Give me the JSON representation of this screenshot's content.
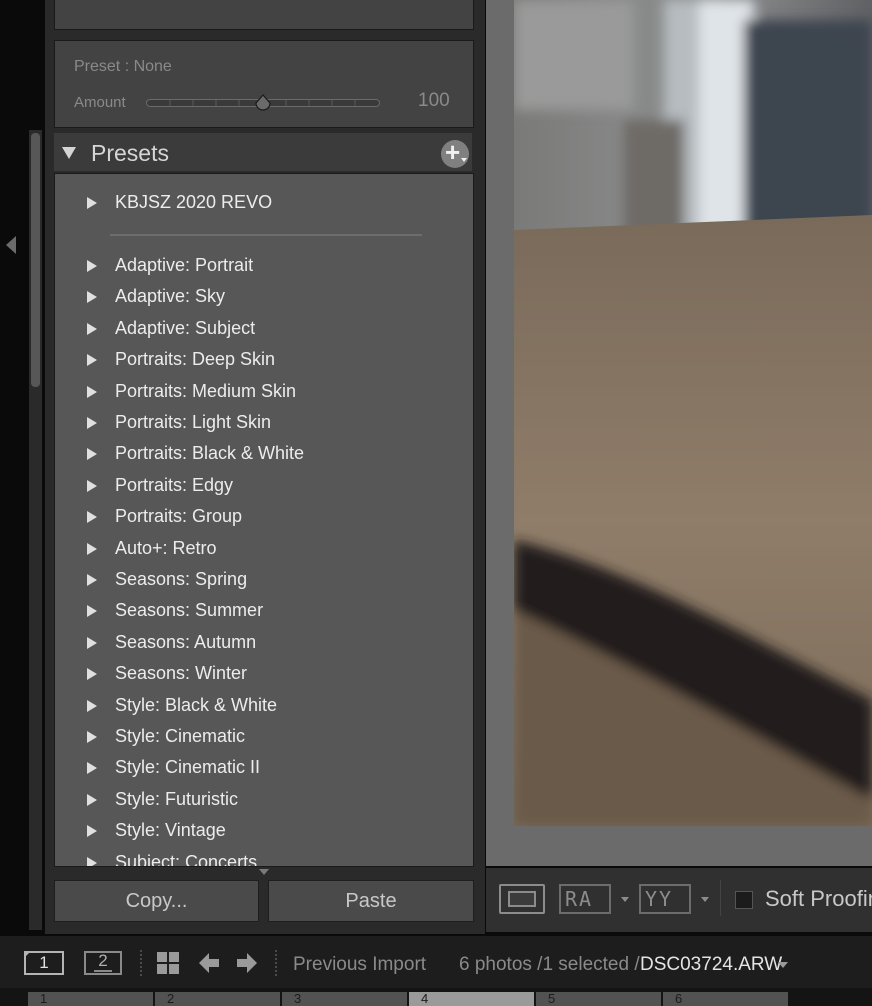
{
  "quick_develop": {
    "preset_line": "Preset : None",
    "amount_label": "Amount",
    "amount_value": "100",
    "amount_fraction": 0.5
  },
  "presets": {
    "title": "Presets",
    "add_icon": "plus-icon",
    "top_group": "KBJSZ 2020 REVO",
    "items": [
      "Adaptive: Portrait",
      "Adaptive: Sky",
      "Adaptive: Subject",
      "Portraits: Deep Skin",
      "Portraits: Medium Skin",
      "Portraits: Light Skin",
      "Portraits: Black & White",
      "Portraits: Edgy",
      "Portraits: Group",
      "Auto+: Retro",
      "Seasons: Spring",
      "Seasons: Summer",
      "Seasons: Autumn",
      "Seasons: Winter",
      "Style: Black & White",
      "Style: Cinematic",
      "Style: Cinematic II",
      "Style: Futuristic",
      "Style: Vintage",
      "Subject: Concerts"
    ]
  },
  "buttons": {
    "copy": "Copy...",
    "paste": "Paste"
  },
  "toolbar": {
    "view_icon": "loupe-view-icon",
    "ra_label": "RA",
    "yy_label": "YY",
    "soft_proofing": "Soft Proofing"
  },
  "bottombar": {
    "screen1": "1",
    "screen2": "2",
    "source": "Previous Import",
    "photos_info": "6 photos /1 selected /",
    "filename": "DSC03724.ARW"
  },
  "filmstrip": {
    "cells": [
      "1",
      "2",
      "3",
      "4",
      "5",
      "6"
    ],
    "selected_index": 3
  },
  "colors": {
    "panel": "#2a2a2a",
    "list_bg": "#575757",
    "text_light": "#ececec",
    "text_dim": "#8a8a8a"
  }
}
